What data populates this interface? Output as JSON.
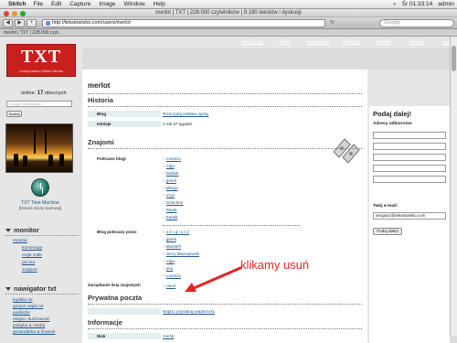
{
  "menubar": {
    "app_name": "Skitch",
    "items": [
      "File",
      "Edit",
      "Capture",
      "Image",
      "Window",
      "Help"
    ],
    "clock": "Śr 01:33:14",
    "user": "admin"
  },
  "window": {
    "title": "merlot | TXT | 228.000 czytelników | 9.180 tekstów i dyskusji"
  },
  "toolbar": {
    "url": "http://tekstowisko.com/users/merlot",
    "search_placeholder": "Google",
    "back": "◀",
    "forward": "▶",
    "add": "+"
  },
  "tab": {
    "label": "merlot | TXT | 228.000 czyt..."
  },
  "site": {
    "logo_text": "TXT",
    "logo_sub": "Independent Citizen Media",
    "nav": [
      "moja do txt",
      "konto",
      "nowa notka",
      "monitoruj",
      "zasady",
      "kontakt",
      "wyloguj"
    ]
  },
  "sidebar": {
    "online_label": "online:",
    "online_count": "17",
    "online_suffix": "obecnych",
    "search_placeholder": "Google Tekstowisko",
    "search_button": "Szukaj",
    "tm_title": "TXT Time Machine",
    "tm_sub": "[historia strony startowej]",
    "monitor_heading": "monitor",
    "monitor_links": [
      "monitor",
      "komentuję",
      "moje notki",
      "poczta",
      "znajomi"
    ],
    "nav_heading": "nawigator txt",
    "nav_links": [
      "topliśta txt",
      "gorące wątki txt",
      "podlistże",
      "religia i duchowość",
      "polityka & media",
      "gospodarka & finanse"
    ]
  },
  "main": {
    "username": "merlot",
    "history_heading": "Historia",
    "rows": [
      {
        "label": "Blog",
        "value": "Przeczytaj ostatnie wpisy",
        "link": true
      },
      {
        "label": "Istnieje",
        "value": "1 rok 47 tygodni",
        "link": false
      }
    ],
    "friends_heading": "Znajomi",
    "recommended_label": "Polecane blogi",
    "recommended": [
      "Lorenzo",
      "Alga",
      "Dalilah",
      "greeli",
      "Mlecja",
      "ożyś",
      "Gretchen",
      "Pepet",
      "Kefalit"
    ],
    "recommended_by_label": "Blog polecany przez",
    "recommended_by": [
      "s e r g i u s z",
      "greeli",
      "MarekPl",
      "Jerzy Maciejewski",
      "Alga",
      "anu",
      "Lorenzo"
    ],
    "manage_label": "Zarządzanie listą znajomych",
    "manage_link": "Usuń",
    "pm_heading": "Prywatna poczta",
    "pm_link": "Napisz prywatną wiadomość",
    "info_heading": "Informacje",
    "nick_label": "Nick",
    "nick_value": "merlot"
  },
  "annotation": {
    "text": "klikamy usuń",
    "color": "#e32521"
  },
  "right": {
    "heading": "Podaj dalej!",
    "recipients_label": "Adresy odbiorców:",
    "email_label": "Twój e-mail:",
    "email_value": "serguisz@tekstowisko.com",
    "submit": "Podaj dalej!"
  },
  "colors": {
    "brand": "#c8201d",
    "link": "#21578a",
    "annotation": "#e32521"
  }
}
